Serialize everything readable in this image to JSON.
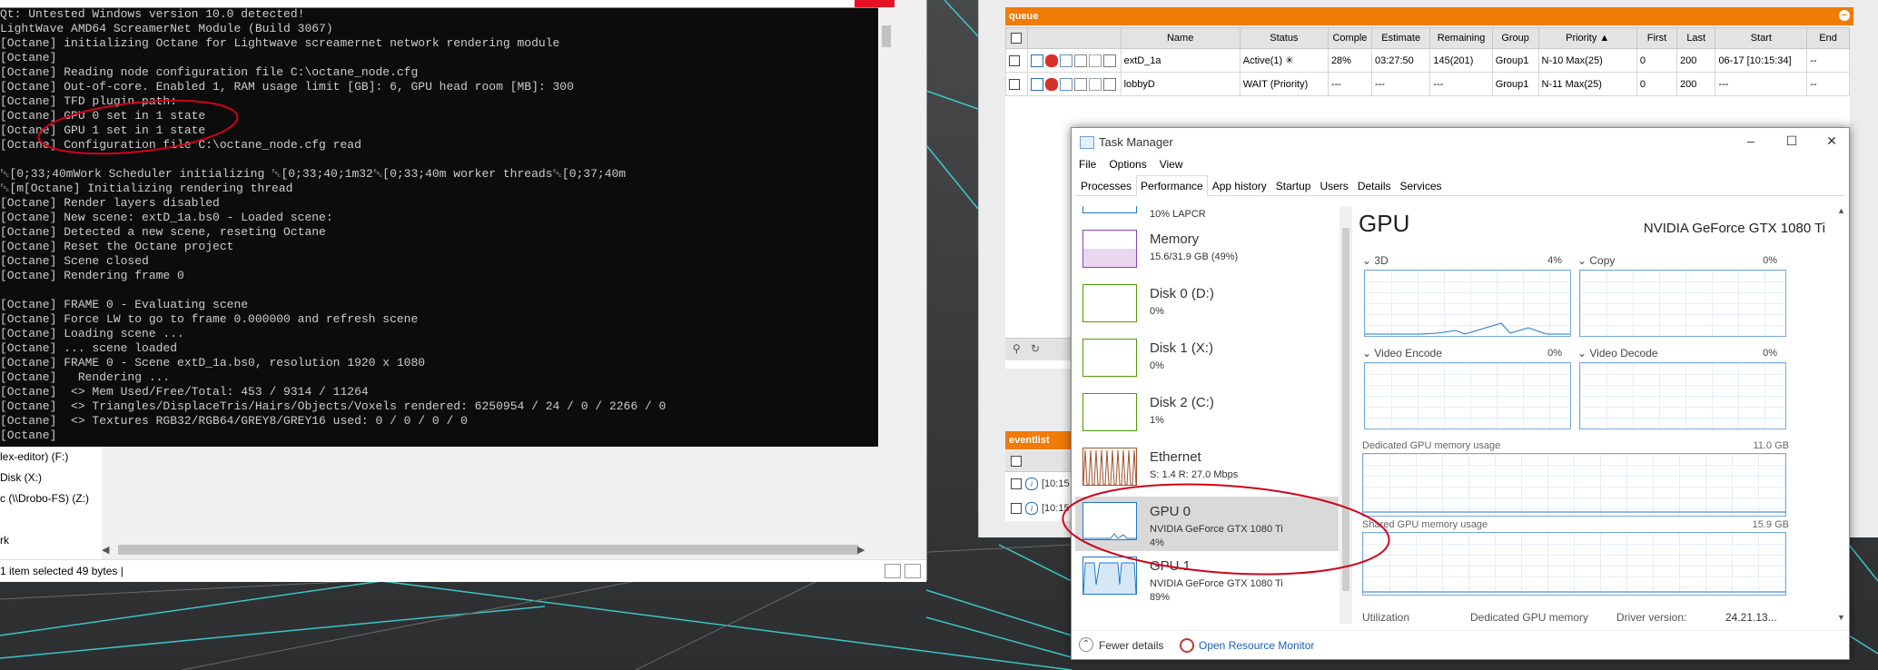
{
  "console": {
    "lines": [
      "Qt: Untested Windows version 10.0 detected!",
      "LightWave AMD64 ScreamerNet Module (Build 3067)",
      "[Octane] initializing Octane for Lightwave screamernet network rendering module",
      "[Octane]",
      "[Octane] Reading node configuration file C:\\octane_node.cfg",
      "[Octane] Out-of-core. Enabled 1, RAM usage limit [GB]: 6, GPU head room [MB]: 300",
      "[Octane] TFD plugin path:",
      "[Octane] GPU 0 set in 1 state",
      "[Octane] GPU 1 set in 1 state",
      "[Octane] Configuration file C:\\octane_node.cfg read",
      "",
      "␛[0;33;40mWork Scheduler initializing ␛[0;33;40;1m32␛[0;33;40m worker threads␛[0;37;40m",
      "␛[m[Octane] Initializing rendering thread",
      "[Octane] Render layers disabled",
      "[Octane] New scene: extD_1a.bs0 - Loaded scene:",
      "[Octane] Detected a new scene, reseting Octane",
      "[Octane] Reset the Octane project",
      "[Octane] Scene closed",
      "[Octane] Rendering frame 0",
      "",
      "[Octane] FRAME 0 - Evaluating scene",
      "[Octane] Force LW to go to frame 0.000000 and refresh scene",
      "[Octane] Loading scene ...",
      "[Octane] ... scene loaded",
      "[Octane] FRAME 0 - Scene extD_1a.bs0, resolution 1920 x 1080",
      "[Octane]   Rendering ...",
      "[Octane]  <> Mem Used/Free/Total: 453 / 9314 / 11264",
      "[Octane]  <> Triangles/DisplaceTris/Hairs/Objects/Voxels rendered: 6250954 / 24 / 0 / 2266 / 0",
      "[Octane]  <> Textures RGB32/RGB64/GREY8/GREY16 used: 0 / 0 / 0 / 0",
      "[Octane]"
    ]
  },
  "explorer": {
    "items": [
      "lex-editor) (F:)",
      "Disk (X:)",
      "c (\\\\Drobo-FS) (Z:)",
      "",
      "rk"
    ],
    "status": "1 item selected  49 bytes  |"
  },
  "queue": {
    "title": "queue",
    "collapse_label": "−",
    "columns": [
      "",
      "",
      "Name",
      "Status",
      "Comple",
      "Estimate",
      "Remaining",
      "Group",
      "Priority ▲",
      "First",
      "Last",
      "Start",
      "End"
    ],
    "rows": [
      [
        "",
        "",
        "extD_1a",
        "Active(1) ✳",
        "28%",
        "03:27:50",
        "145(201)",
        "Group1",
        "N-10 Max(25)",
        "0",
        "200",
        "06-17 [10:15:34]",
        "--"
      ],
      [
        "",
        "",
        "lobbyD",
        "WAIT (Priority)",
        "---",
        "---",
        "---",
        "Group1",
        "N-11 Max(25)",
        "0",
        "200",
        "---",
        "--"
      ]
    ],
    "footer_icons": [
      "search-icon",
      "refresh-icon"
    ]
  },
  "eventlist": {
    "title": "eventlist",
    "rows": [
      "[10:15",
      "[10:15"
    ]
  },
  "taskmgr": {
    "title": "Task Manager",
    "menu": [
      "File",
      "Options",
      "View"
    ],
    "tabs": [
      "Processes",
      "Performance",
      "App history",
      "Startup",
      "Users",
      "Details",
      "Services"
    ],
    "active_tab": "Performance",
    "partial_item_sub": "10% LAPCR",
    "resources": [
      {
        "name": "Memory",
        "sub1": "15.6/31.9 GB (49%)",
        "sub2": "",
        "color": "#8e44ad"
      },
      {
        "name": "Disk 0 (D:)",
        "sub1": "0%",
        "sub2": "",
        "color": "#4d9a06"
      },
      {
        "name": "Disk 1 (X:)",
        "sub1": "0%",
        "sub2": "",
        "color": "#4d9a06"
      },
      {
        "name": "Disk 2 (C:)",
        "sub1": "1%",
        "sub2": "",
        "color": "#4d9a06"
      },
      {
        "name": "Ethernet",
        "sub1": "S: 1.4  R: 27.0 Mbps",
        "sub2": "",
        "color": "#a0522d"
      },
      {
        "name": "GPU 0",
        "sub1": "NVIDIA GeForce GTX 1080 Ti",
        "sub2": "4%",
        "color": "#1e78c8"
      },
      {
        "name": "GPU 1",
        "sub1": "NVIDIA GeForce GTX 1080 Ti",
        "sub2": "89%",
        "color": "#1e78c8"
      }
    ],
    "gpu": {
      "title": "GPU",
      "model": "NVIDIA GeForce GTX 1080 Ti",
      "engines": [
        {
          "label": "3D",
          "pct": "4%"
        },
        {
          "label": "Copy",
          "pct": "0%"
        },
        {
          "label": "Video Encode",
          "pct": "0%"
        },
        {
          "label": "Video Decode",
          "pct": "0%"
        }
      ],
      "dedicated_label": "Dedicated GPU memory usage",
      "dedicated_max": "11.0 GB",
      "shared_label": "Shared GPU memory usage",
      "shared_max": "15.9 GB",
      "bottom_utilization": "Utilization",
      "bottom_dedicated": "Dedicated GPU memory",
      "bottom_driver": "Driver version:",
      "bottom_driver_val": "24.21.13..."
    },
    "fewer_details": "Fewer details",
    "open_resource_monitor": "Open Resource Monitor"
  },
  "colors": {
    "console_bg": "#0c0c0c",
    "queue_orange": "#f07b05",
    "annotation_red": "#d0021b",
    "gpu_blue": "#1e78c8"
  }
}
